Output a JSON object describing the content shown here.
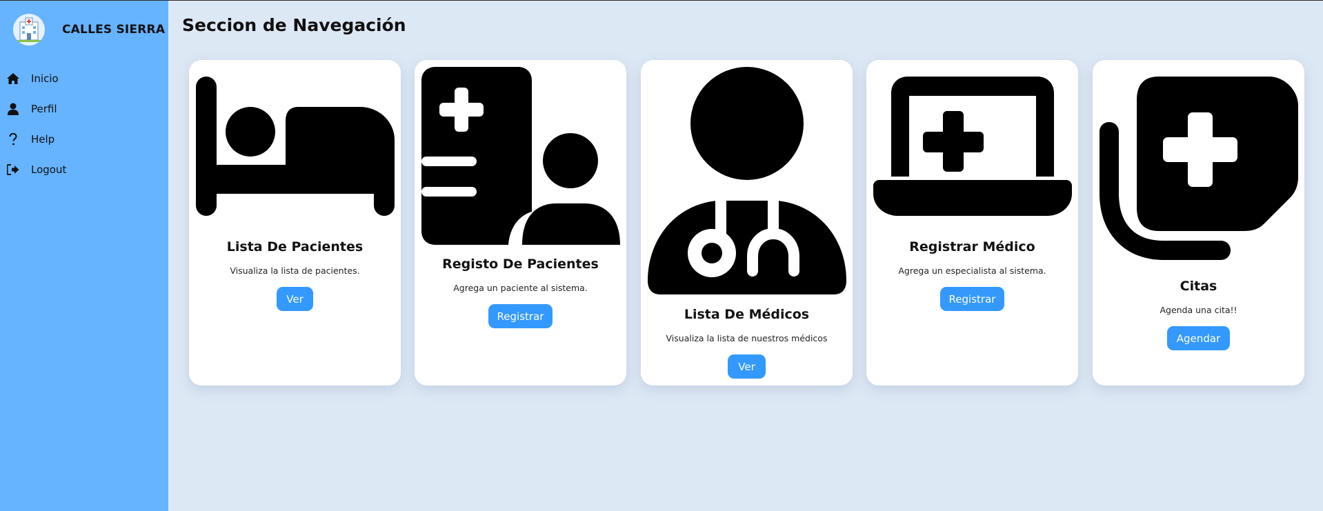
{
  "sidebar": {
    "brand_name": "CALLES SIERRA",
    "logo_icon": "hospital-logo",
    "items": [
      {
        "label": "Inicio",
        "icon": "home-icon"
      },
      {
        "label": "Perfil",
        "icon": "user-icon"
      },
      {
        "label": "Help",
        "icon": "question-icon"
      },
      {
        "label": "Logout",
        "icon": "logout-icon"
      }
    ]
  },
  "main": {
    "title": "Seccion de Navegación",
    "cards": [
      {
        "title": "Lista De Pacientes",
        "description": "Visualiza la lista de pacientes.",
        "button": "Ver",
        "icon": "bed-icon"
      },
      {
        "title": "Registo De Pacientes",
        "description": "Agrega un paciente al sistema.",
        "button": "Registrar",
        "icon": "patient-register-icon"
      },
      {
        "title": "Lista De Médicos",
        "description": "Visualiza la lista de nuestros médicos",
        "button": "Ver",
        "icon": "doctor-icon"
      },
      {
        "title": "Registrar Médico",
        "description": "Agrega un especialista al sistema.",
        "button": "Registrar",
        "icon": "laptop-medical-icon"
      },
      {
        "title": "Citas",
        "description": "Agenda una cita!!",
        "button": "Agendar",
        "icon": "notes-medical-icon"
      }
    ]
  },
  "colors": {
    "sidebar_bg": "#66b3ff",
    "page_bg": "#dde8f5",
    "button_bg": "#3399ff",
    "card_bg": "#ffffff"
  }
}
